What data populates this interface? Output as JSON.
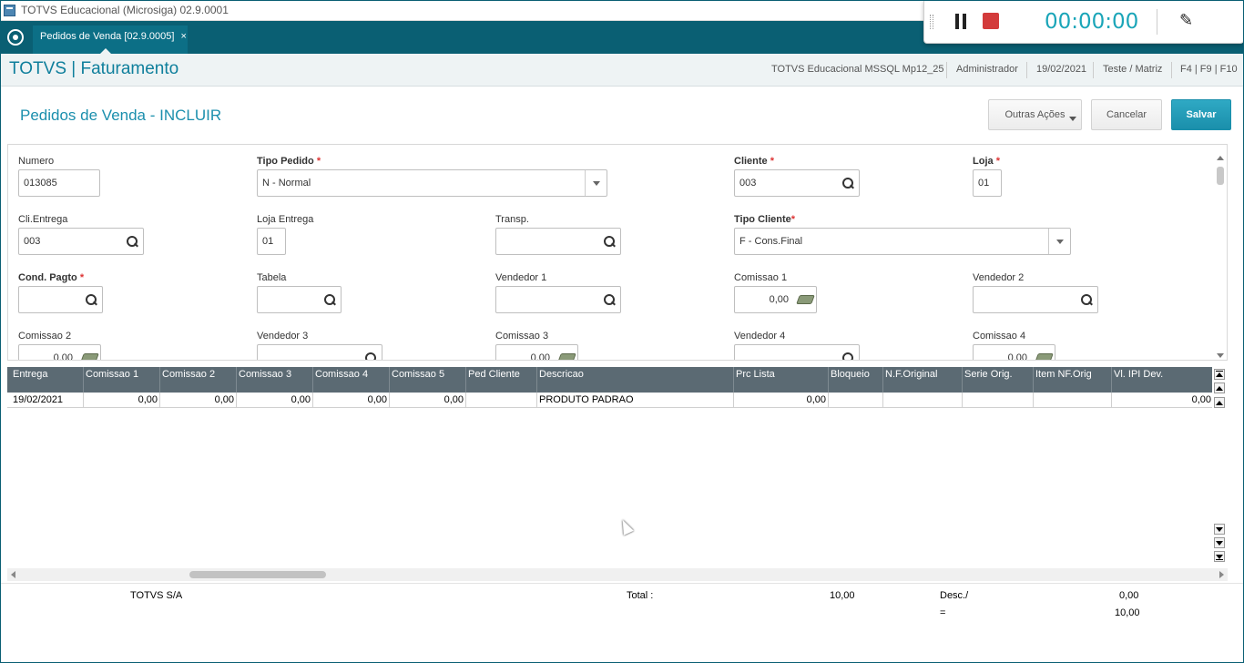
{
  "window": {
    "title": "TOTVS Educacional (Microsiga) 02.9.0001"
  },
  "tabs": [
    {
      "label": "Pedidos de Venda [02.9.0005]",
      "close": "×"
    }
  ],
  "recorder": {
    "timer": "00:00:00"
  },
  "module": {
    "title": "TOTVS | Faturamento",
    "environment": "TOTVS Educacional MSSQL Mp12_25",
    "user": "Administrador",
    "date": "19/02/2021",
    "branch": "Teste / Matriz",
    "shortcuts": "F4 | F9 | F10"
  },
  "page": {
    "title": "Pedidos de Venda - INCLUIR",
    "buttons": {
      "other": "Outras Ações",
      "cancel": "Cancelar",
      "save": "Salvar"
    }
  },
  "form": {
    "numero": {
      "label": "Numero",
      "value": "013085"
    },
    "tipo_pedido": {
      "label": "Tipo Pedido",
      "value": "N - Normal"
    },
    "cliente": {
      "label": "Cliente",
      "value": "003"
    },
    "loja": {
      "label": "Loja",
      "value": "01"
    },
    "cli_entrega": {
      "label": "Cli.Entrega",
      "value": "003"
    },
    "loja_entrega": {
      "label": "Loja Entrega",
      "value": "01"
    },
    "transp": {
      "label": "Transp.",
      "value": ""
    },
    "tipo_cliente": {
      "label": "Tipo Cliente",
      "value": "F - Cons.Final"
    },
    "cond_pagto": {
      "label": "Cond. Pagto",
      "value": ""
    },
    "tabela": {
      "label": "Tabela",
      "value": ""
    },
    "vendedor1": {
      "label": "Vendedor 1",
      "value": ""
    },
    "comissao1": {
      "label": "Comissao 1",
      "value": "0,00"
    },
    "vendedor2": {
      "label": "Vendedor 2",
      "value": ""
    },
    "comissao2": {
      "label": "Comissao 2",
      "value": "0,00"
    },
    "vendedor3": {
      "label": "Vendedor 3",
      "value": ""
    },
    "comissao3": {
      "label": "Comissao 3",
      "value": "0,00"
    },
    "vendedor4": {
      "label": "Vendedor 4",
      "value": ""
    },
    "comissao4": {
      "label": "Comissao 4",
      "value": "0,00"
    },
    "required_mark": "*"
  },
  "grid": {
    "columns": [
      "Entrega",
      "Comissao 1",
      "Comissao 2",
      "Comissao 3",
      "Comissao 4",
      "Comissao 5",
      "Ped Cliente",
      "Descricao",
      "Prc Lista",
      "Bloqueio",
      "N.F.Original",
      "Serie Orig.",
      "Item NF.Orig",
      "Vl. IPI Dev."
    ],
    "rows": [
      [
        "19/02/2021",
        "0,00",
        "0,00",
        "0,00",
        "0,00",
        "0,00",
        "",
        "PRODUTO PADRAO",
        "0,00",
        "",
        "",
        "",
        "",
        "0,00"
      ]
    ]
  },
  "footer": {
    "company": "TOTVS S/A",
    "total_label": "Total :",
    "total_value": "10,00",
    "desc_label": "Desc./",
    "desc_value": "0,00",
    "eq_label": "=",
    "eq_value": "10,00"
  }
}
